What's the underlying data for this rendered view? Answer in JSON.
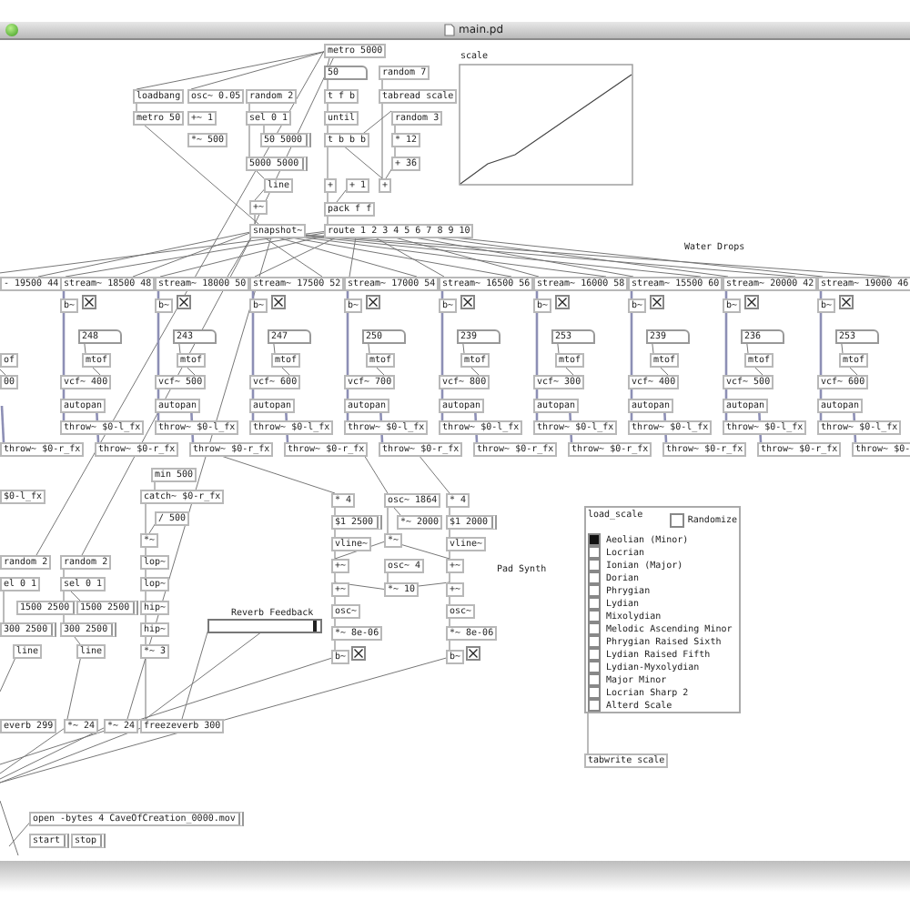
{
  "window": {
    "title": "main.pd"
  },
  "objects": [
    {
      "kind": "object",
      "text": "metro 5000"
    },
    {
      "kind": "number",
      "text": "50"
    },
    {
      "kind": "object",
      "text": "random 7"
    },
    {
      "kind": "object",
      "text": "loadbang"
    },
    {
      "kind": "object",
      "text": "osc~ 0.05"
    },
    {
      "kind": "object",
      "text": "random 2"
    },
    {
      "kind": "object",
      "text": "t f b"
    },
    {
      "kind": "object",
      "text": "tabread scale"
    },
    {
      "kind": "object",
      "text": "metro 50"
    },
    {
      "kind": "object",
      "text": "+~ 1"
    },
    {
      "kind": "object",
      "text": "sel 0 1"
    },
    {
      "kind": "object",
      "text": "until"
    },
    {
      "kind": "object",
      "text": "random 3"
    },
    {
      "kind": "object",
      "text": "*~ 500"
    },
    {
      "kind": "message",
      "text": "50 5000"
    },
    {
      "kind": "object",
      "text": "t b b b"
    },
    {
      "kind": "object",
      "text": "* 12"
    },
    {
      "kind": "message",
      "text": "5000 5000"
    },
    {
      "kind": "object",
      "text": "+ 36"
    },
    {
      "kind": "object",
      "text": "line"
    },
    {
      "kind": "object",
      "text": "+"
    },
    {
      "kind": "object",
      "text": "+ 1"
    },
    {
      "kind": "object",
      "text": "+"
    },
    {
      "kind": "object",
      "text": "+~"
    },
    {
      "kind": "object",
      "text": "pack f f"
    },
    {
      "kind": "object",
      "text": "snapshot~"
    },
    {
      "kind": "object",
      "text": "route 1 2 3 4 5 6 7 8 9 10"
    },
    {
      "kind": "comment",
      "text": "Water Drops"
    },
    {
      "kind": "object",
      "text": "min 500"
    },
    {
      "kind": "object",
      "text": "$0-l_fx"
    },
    {
      "kind": "object",
      "text": "catch~ $0-r_fx"
    },
    {
      "kind": "object",
      "text": "* 4"
    },
    {
      "kind": "object",
      "text": "osc~ 1864"
    },
    {
      "kind": "object",
      "text": "* 4"
    },
    {
      "kind": "object",
      "text": "/ 500"
    },
    {
      "kind": "message",
      "text": "$1 2500"
    },
    {
      "kind": "object",
      "text": "*~ 2000"
    },
    {
      "kind": "message",
      "text": "$1 2000"
    },
    {
      "kind": "object",
      "text": "*~"
    },
    {
      "kind": "object",
      "text": "*~"
    },
    {
      "kind": "object",
      "text": "vline~"
    },
    {
      "kind": "object",
      "text": "vline~"
    },
    {
      "kind": "object",
      "text": "random 2"
    },
    {
      "kind": "object",
      "text": "random 2"
    },
    {
      "kind": "object",
      "text": "lop~"
    },
    {
      "kind": "object",
      "text": "+~"
    },
    {
      "kind": "object",
      "text": "osc~ 4"
    },
    {
      "kind": "object",
      "text": "+~"
    },
    {
      "kind": "comment",
      "text": "Pad Synth"
    },
    {
      "kind": "object",
      "text": "el 0 1"
    },
    {
      "kind": "object",
      "text": "sel 0 1"
    },
    {
      "kind": "object",
      "text": "lop~"
    },
    {
      "kind": "object",
      "text": "+~"
    },
    {
      "kind": "object",
      "text": "*~ 10"
    },
    {
      "kind": "object",
      "text": "+~"
    },
    {
      "kind": "message",
      "text": "1500 2500"
    },
    {
      "kind": "message",
      "text": "1500 2500"
    },
    {
      "kind": "object",
      "text": "hip~"
    },
    {
      "kind": "object",
      "text": "osc~"
    },
    {
      "kind": "object",
      "text": "osc~"
    },
    {
      "kind": "message",
      "text": "300 2500"
    },
    {
      "kind": "message",
      "text": "300 2500"
    },
    {
      "kind": "object",
      "text": "hip~"
    },
    {
      "kind": "object",
      "text": "*~ 8e-06"
    },
    {
      "kind": "object",
      "text": "*~ 8e-06"
    },
    {
      "kind": "object",
      "text": "line"
    },
    {
      "kind": "object",
      "text": "line"
    },
    {
      "kind": "object",
      "text": "*~ 3"
    },
    {
      "kind": "object",
      "text": "b~"
    },
    {
      "kind": "toggle",
      "checked": true
    },
    {
      "kind": "object",
      "text": "b~"
    },
    {
      "kind": "toggle",
      "checked": true
    },
    {
      "kind": "object",
      "text": "everb 299"
    },
    {
      "kind": "object",
      "text": "*~ 24"
    },
    {
      "kind": "object",
      "text": "*~ 24"
    },
    {
      "kind": "object",
      "text": "freezeverb 300"
    },
    {
      "kind": "message",
      "text": "open -bytes 4 CaveOfCreation_0000.mov"
    },
    {
      "kind": "message",
      "text": "start"
    },
    {
      "kind": "message",
      "text": "stop"
    }
  ],
  "voices": [
    {
      "stream": "- 19500 44",
      "mtof": "of",
      "vcf": "00",
      "throw_r": "throw~ $0-r_fx"
    },
    {
      "stream": "stream~ 18500 48",
      "bang": "b~",
      "on": true,
      "number": "248",
      "mtof": "mtof",
      "vcf": "vcf~ 400",
      "autopan": "autopan",
      "throw_l": "throw~ $0-l_fx",
      "throw_r": "throw~ $0-r_fx"
    },
    {
      "stream": "stream~ 18000 50",
      "bang": "b~",
      "on": true,
      "number": "243",
      "mtof": "mtof",
      "vcf": "vcf~ 500",
      "autopan": "autopan",
      "throw_l": "throw~ $0-l_fx",
      "throw_r": "throw~ $0-r_fx"
    },
    {
      "stream": "stream~ 17500 52",
      "bang": "b~",
      "on": true,
      "number": "247",
      "mtof": "mtof",
      "vcf": "vcf~ 600",
      "autopan": "autopan",
      "throw_l": "throw~ $0-l_fx",
      "throw_r": "throw~ $0-r_fx"
    },
    {
      "stream": "stream~ 17000 54",
      "bang": "b~",
      "on": true,
      "number": "250",
      "mtof": "mtof",
      "vcf": "vcf~ 700",
      "autopan": "autopan",
      "throw_l": "throw~ $0-l_fx",
      "throw_r": "throw~ $0-r_fx"
    },
    {
      "stream": "stream~ 16500 56",
      "bang": "b~",
      "on": true,
      "number": "239",
      "mtof": "mtof",
      "vcf": "vcf~ 800",
      "autopan": "autopan",
      "throw_l": "throw~ $0-l_fx",
      "throw_r": "throw~ $0-r_fx"
    },
    {
      "stream": "stream~ 16000 58",
      "bang": "b~",
      "on": true,
      "number": "253",
      "mtof": "mtof",
      "vcf": "vcf~ 300",
      "autopan": "autopan",
      "throw_l": "throw~ $0-l_fx",
      "throw_r": "throw~ $0-r_fx"
    },
    {
      "stream": "stream~ 15500 60",
      "bang": "b~",
      "on": true,
      "number": "239",
      "mtof": "mtof",
      "vcf": "vcf~ 400",
      "autopan": "autopan",
      "throw_l": "throw~ $0-l_fx",
      "throw_r": "throw~ $0-r_fx"
    },
    {
      "stream": "stream~ 20000 42",
      "bang": "b~",
      "on": true,
      "number": "236",
      "mtof": "mtof",
      "vcf": "vcf~ 500",
      "autopan": "autopan",
      "throw_l": "throw~ $0-l_fx",
      "throw_r": "throw~ $0-r_fx"
    },
    {
      "stream": "stream~ 19000 46",
      "bang": "b~",
      "on": true,
      "number": "253",
      "mtof": "mtof",
      "vcf": "vcf~ 600",
      "autopan": "autopan",
      "throw_l": "throw~ $0-l_fx",
      "throw_r": "throw~ $0-"
    }
  ],
  "graph": {
    "label": "scale"
  },
  "reverb": {
    "label": "Reverb Feedback",
    "level": 0.93
  },
  "scale_selector": {
    "label": "load_scale",
    "randomize": {
      "label": "Randomize",
      "checked": false
    },
    "options": [
      {
        "label": "Aeolian (Minor)",
        "selected": true
      },
      {
        "label": "Locrian",
        "selected": false
      },
      {
        "label": "Ionian (Major)",
        "selected": false
      },
      {
        "label": "Dorian",
        "selected": false
      },
      {
        "label": "Phrygian",
        "selected": false
      },
      {
        "label": "Lydian",
        "selected": false
      },
      {
        "label": "Mixolydian",
        "selected": false
      },
      {
        "label": "Melodic Ascending Minor",
        "selected": false
      },
      {
        "label": "Phrygian Raised Sixth",
        "selected": false
      },
      {
        "label": "Lydian Raised Fifth",
        "selected": false
      },
      {
        "label": "Lydian-Myxolydian",
        "selected": false
      },
      {
        "label": "Major Minor",
        "selected": false
      },
      {
        "label": "Locrian Sharp 2",
        "selected": false
      },
      {
        "label": "Alterd Scale",
        "selected": false
      }
    ],
    "tabwrite": "tabwrite scale"
  }
}
